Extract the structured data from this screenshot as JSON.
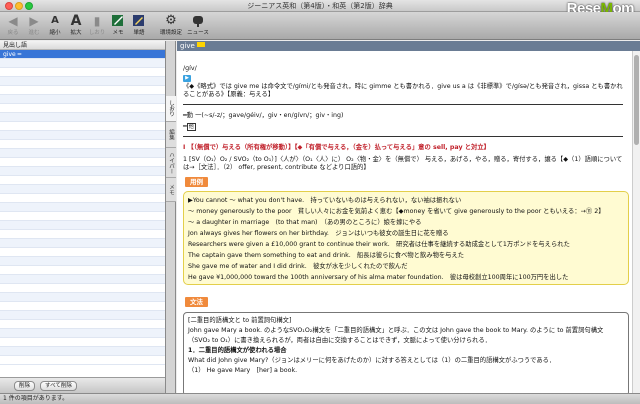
{
  "window": {
    "title": "ジーニアス英和（第4版）・和英（第2版）辞典"
  },
  "brand": {
    "name_a": "Rese",
    "name_o": "M",
    "name_b": "om"
  },
  "toolbar": {
    "back": "戻る",
    "forward": "進む",
    "shrink": "縮小",
    "enlarge": "拡大",
    "bookmark": "しおり",
    "memo": "メモ",
    "wordbook": "単語",
    "settings": "環境設定",
    "news": "ニュース",
    "icons": {
      "back": "left-arrow-icon",
      "forward": "right-arrow-icon",
      "shrink": "small-a-icon",
      "enlarge": "large-a-icon",
      "bookmark": "bookmark-icon",
      "memo": "pen-icon",
      "wordbook": "pencil-book-icon",
      "settings": "gear-icon",
      "news": "mailbox-icon"
    }
  },
  "sidebar": {
    "header": "見出し語",
    "selected": "give ━",
    "delete_label": "削除",
    "delete_all_label": "すべて削除"
  },
  "tabs": [
    "しおり",
    "編集",
    "ハイパー",
    "メモ"
  ],
  "entry": {
    "headword": "give",
    "pron": "/ɡív/",
    "note1": "《◆《略式》では give me は命令文で/ɡími/とも発音され，時に gimme とも書かれる．give us a は《非標準》で/ɡísə/とも発音され，gissa とも書かれることがある》【原義：与える】",
    "forms": "一(~s/-z/；gave/ɡéiv/，giv・en/ɡívn/；giv・ing)",
    "forms_mark": "━動",
    "sense_head": "I 【（無償で）与える（所有権が移動）】【◆「有償で与える，（金を）払って与える」意の sell, pay と対立】",
    "sense1": "1 [SV（O₁）O₂ / SVO₂（to O₁）]〈人が〉（O₁〈人〉に） O₂〈物・金〉を（無償で） 与える，あげる，やる，贈る，寄付する，譲る【◆（1）語順については→［文法］．（2） offer, present, contribute などより口語的】",
    "examples_label": "用例",
    "examples": [
      "▶You cannot ～ what you don't have.　持っていないものは与えられない，ない袖は振れない",
      "～ money generously to the poor　貧しい人々にお金を気前よく恵む【◆money を省いて give generously to the poor ともいえる：→",
      "～ a daughter in marriage　(to that man)　（あの男のところに）娘を嫁にやる",
      "Jon always gives her flowers on her birthday.　ジョンはいつも彼女の誕生日に花を贈る",
      "Researchers were given a £10,000 grant to continue their work.　研究者は仕事を継続する助成金として1万ポンドを与えられた",
      "The captain gave them something to eat and drink.　船長は彼らに食べ物と飲み物を与えた",
      "She gave me of water and I did drink.　彼女が水を少しくれたので飲んだ",
      "He gave ¥1,000,000 toward the 100th anniversary of his alma mater foundation.　彼は母校創立100周年に100万円を出した"
    ],
    "ex_tail": "⑪ 2】",
    "grammar_label": "文法",
    "grammar": [
      "[二重目的語構文と to 前置詞句構文]",
      "John gave Mary a book. のようなSVO₁O₂構文を「二重目的語構文」と呼ぶ．この文は John gave the book to Mary. のように to 前置詞句構文",
      "（SVO₂ to O₁）に書き換えられるが，両者は自由に交換することはできず，文脈によって使い分けられる．",
      "1．二重目的語構文が使われる場合",
      "What did John give Mary?（ジョンはメリーに何をあげたのか）に対する答えとしては（1）の二重目的語構文がふつうである．",
      "（1） He gave Mary　[her] a book."
    ]
  },
  "status": {
    "text": "1 件の項目があります。"
  }
}
